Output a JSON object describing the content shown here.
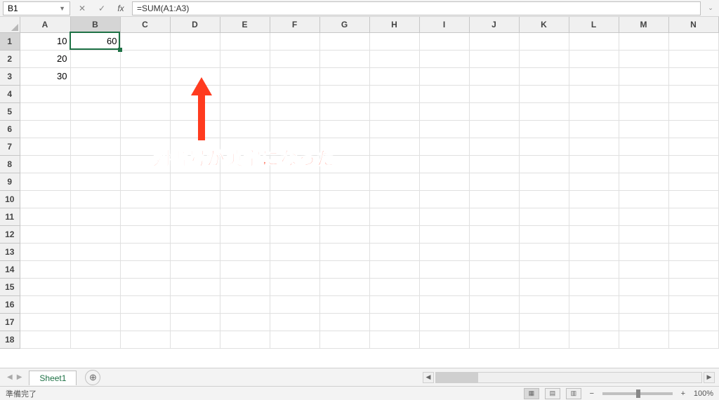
{
  "formula_bar": {
    "cell_ref": "B1",
    "formula": "=SUM(A1:A3)"
  },
  "columns": [
    "A",
    "B",
    "C",
    "D",
    "E",
    "F",
    "G",
    "H",
    "I",
    "J",
    "K",
    "L",
    "M",
    "N"
  ],
  "row_count": 18,
  "active_cell": {
    "col": "B",
    "row": 1
  },
  "cells": {
    "A1": "10",
    "A2": "20",
    "A3": "30",
    "B1": "60"
  },
  "annotation": {
    "text": "列番号が英字になった"
  },
  "sheet_tabs": {
    "active": "Sheet1"
  },
  "status": {
    "ready": "準備完了",
    "zoom": "100%"
  }
}
